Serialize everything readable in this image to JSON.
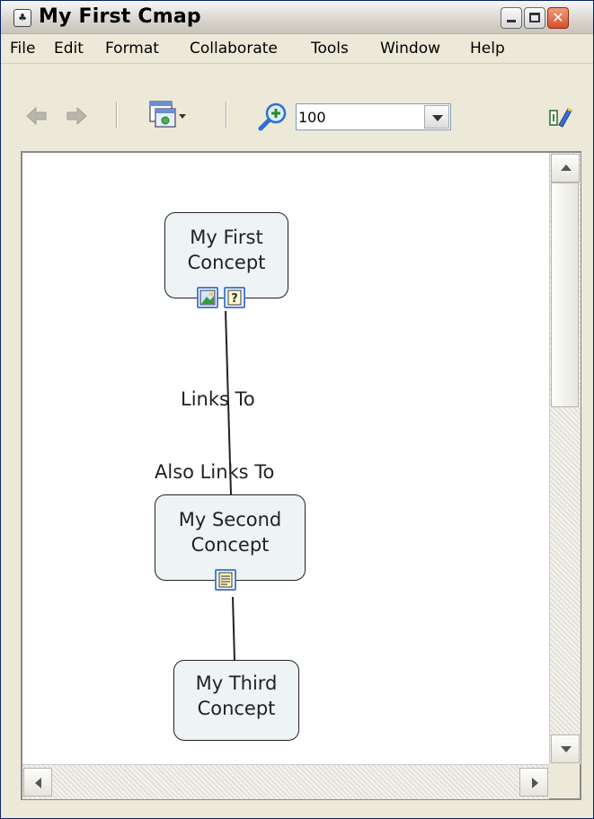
{
  "window": {
    "title": "My First Cmap",
    "app_icon": "cmap-app-icon",
    "controls": [
      "minimize",
      "maximize",
      "close"
    ]
  },
  "menu": {
    "items": [
      "File",
      "Edit",
      "Format",
      "Collaborate",
      "Tools",
      "Window",
      "Help"
    ]
  },
  "toolbar": {
    "back_icon": "back-arrow-icon",
    "forward_icon": "forward-arrow-icon",
    "layout_icon": "layout-dropdown-icon",
    "zoom_icon": "zoom-in-icon",
    "zoom_value": "100",
    "extra_icon": "styles-palette-icon"
  },
  "cmap": {
    "concepts": [
      {
        "id": "c1",
        "label_line1": "My First",
        "label_line2": "Concept",
        "resources": [
          "image-resource-icon",
          "help-resource-icon"
        ]
      },
      {
        "id": "c2",
        "label_line1": "My Second",
        "label_line2": "Concept",
        "resources": [
          "document-resource-icon"
        ]
      },
      {
        "id": "c3",
        "label_line1": "My Third",
        "label_line2": "Concept",
        "resources": []
      }
    ],
    "linking_phrases": [
      {
        "id": "l1",
        "label": "Links To"
      },
      {
        "id": "l2",
        "label": "Also Links To"
      }
    ]
  },
  "colors": {
    "concept_fill": "#eef3f6",
    "concept_border": "#222222",
    "resource_border": "#4a7fd8",
    "window_face": "#ece9d8"
  }
}
